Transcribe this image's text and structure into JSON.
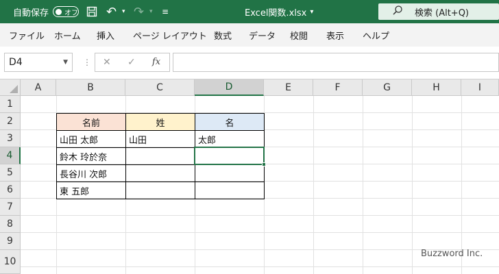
{
  "titlebar": {
    "autosave_label": "自動保存",
    "autosave_state": "オフ",
    "filename": "Excel関数.xlsx",
    "filename_chevron": "⌄",
    "search_placeholder": "検索 (Alt+Q)",
    "accent_color": "#217346"
  },
  "ribbon": {
    "tabs": [
      "ファイル",
      "ホーム",
      "挿入",
      "ページ レイアウト",
      "数式",
      "データ",
      "校閲",
      "表示",
      "ヘルプ"
    ]
  },
  "formula_bar": {
    "name_box": "D4",
    "fx_label": "fx",
    "formula": ""
  },
  "sheet": {
    "columns": [
      "A",
      "B",
      "C",
      "D",
      "E",
      "F",
      "G",
      "H",
      "I"
    ],
    "rows": [
      "1",
      "2",
      "3",
      "4",
      "5",
      "6",
      "7",
      "8",
      "9",
      "10"
    ],
    "selected_column": "D",
    "selected_row": "4",
    "table": {
      "headers": [
        "名前",
        "姓",
        "名"
      ],
      "rows": [
        [
          "山田 太郎",
          "山田",
          "太郎"
        ],
        [
          "鈴木 玲於奈",
          "",
          ""
        ],
        [
          "長谷川 次郎",
          "",
          ""
        ],
        [
          "東 五郎",
          "",
          ""
        ]
      ]
    }
  },
  "watermark": "Buzzword Inc."
}
